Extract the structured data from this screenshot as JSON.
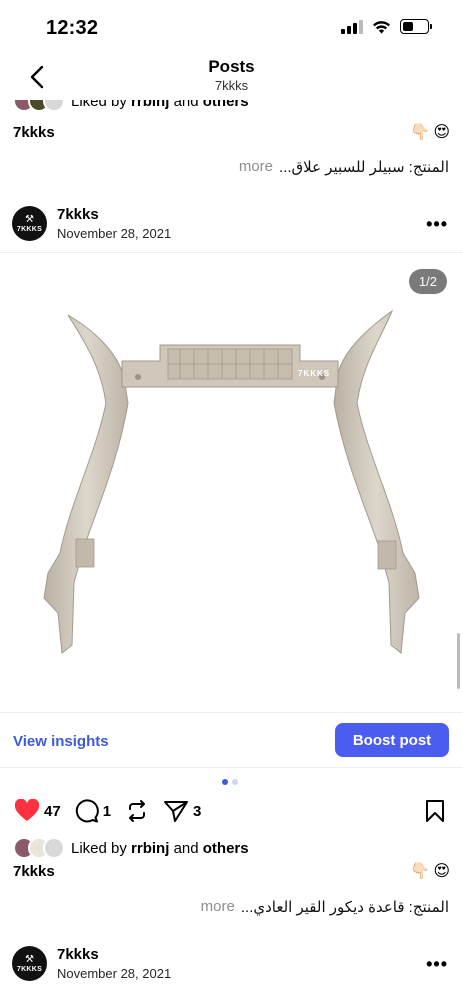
{
  "status": {
    "time": "12:32"
  },
  "nav": {
    "title": "Posts",
    "subtitle": "7kkks"
  },
  "prev_post": {
    "liked_by": "Liked by",
    "liked_user": "rrbinj",
    "and": "and",
    "others": "others",
    "caption_user": "7kkks",
    "caption_text": "المنتج: سبيلر للسبير علاق...",
    "more": "more"
  },
  "post": {
    "logo_text": "7KKKS",
    "username": "7kkks",
    "date": "November 28, 2021",
    "menu_icon": "more-horizontal-icon",
    "pager": "1/2",
    "watermark": "7KKKS",
    "view_insights": "View insights",
    "boost": "Boost post",
    "likes": "47",
    "comments": "1",
    "shares": "3",
    "liked_by": "Liked by",
    "liked_user": "rrbinj",
    "and": "and",
    "others": "others",
    "caption_user": "7kkks",
    "caption_text": "المنتج: قاعدة ديكور القير العادي...",
    "more": "more"
  },
  "next_post": {
    "logo_text": "7KKKS",
    "username": "7kkks",
    "date": "November 28, 2021"
  },
  "colors": {
    "accent": "#4a5df0",
    "like": "#ff3040",
    "link": "#3d5bd9"
  }
}
